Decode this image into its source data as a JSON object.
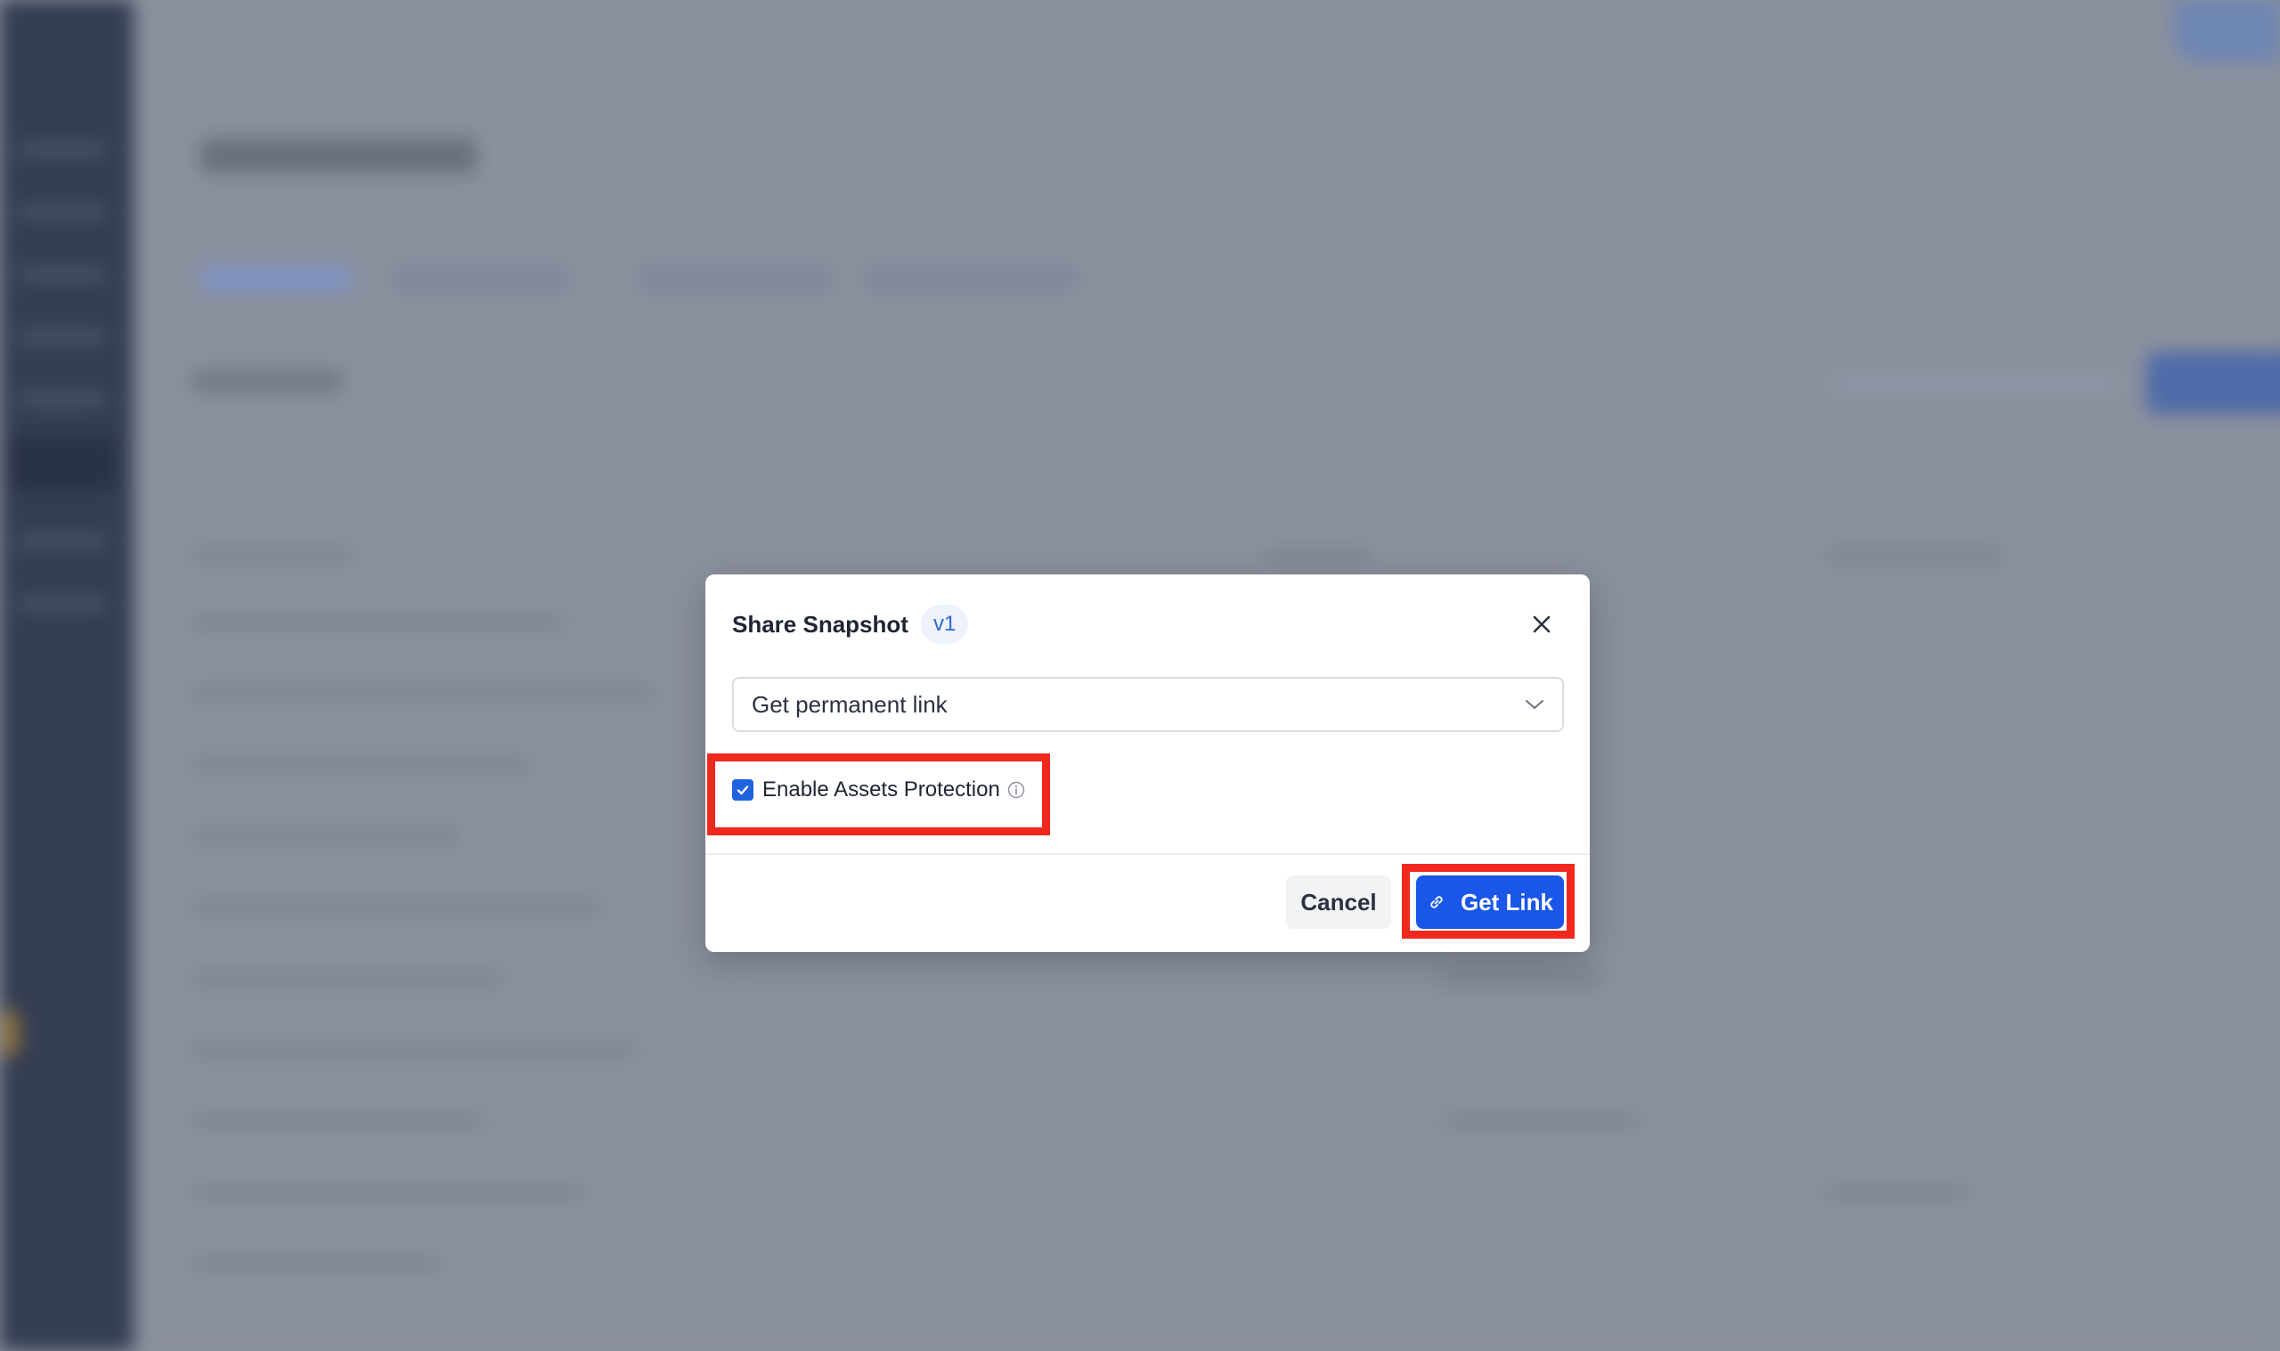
{
  "modal": {
    "title": "Share Snapshot",
    "version_badge": "v1",
    "close_icon": "close-icon",
    "link_type_select": {
      "value": "Get permanent link",
      "icon": "chevron-down-icon"
    },
    "assets_protection": {
      "label": "Enable Assets Protection",
      "checked": true,
      "info_icon": "info-icon"
    },
    "cancel_label": "Cancel",
    "get_link_label": "Get Link",
    "get_link_icon": "link-icon"
  },
  "colors": {
    "primary": "#1a56e8",
    "checkbox": "#1f63e0",
    "highlight": "#f0281e",
    "overlay": "#8a8f9c",
    "badge_bg": "#eef2fa",
    "badge_text": "#2f6ad9"
  }
}
